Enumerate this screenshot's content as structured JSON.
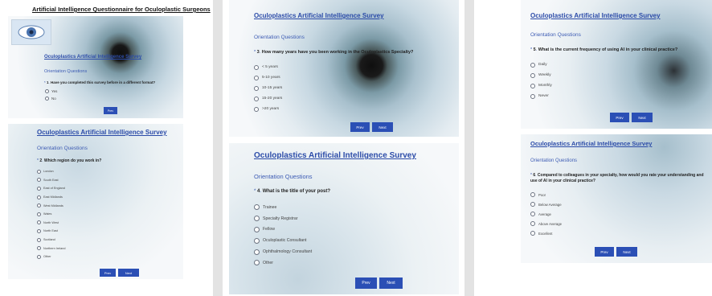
{
  "doc_title": "Artificial Intelligence Questionnaire for Oculoplastic Surgeons",
  "survey_title": "Oculoplastics Artificial Intelligence Survey",
  "section": "Orientation Questions",
  "buttons": {
    "prev": "Prev",
    "next": "Next"
  },
  "screens": [
    {
      "number": "1",
      "question": "Have you completed this survey before in a different format?",
      "options": [
        "Yes",
        "No"
      ]
    },
    {
      "number": "2",
      "question": "Which region do you work in?",
      "options": [
        "London",
        "South East",
        "East of England",
        "East Midlands",
        "West Midlands",
        "Wales",
        "North West",
        "North East",
        "Scotland",
        "Northern Ireland",
        "Other"
      ]
    },
    {
      "number": "3",
      "question": "How many years have you been working in the Oculoplastics Specialty?",
      "options": [
        "< 5 years",
        "5-10 years",
        "10-15 years",
        "15-20 years",
        ">20 years"
      ]
    },
    {
      "number": "4",
      "question": "What is the title of your post?",
      "options": [
        "Trainee",
        "Specialty Registrar",
        "Fellow",
        "Oculoplastic Consultant",
        "Ophthalmology Consultant",
        "Other"
      ]
    },
    {
      "number": "5",
      "question": "What is the current frequency of using AI in your clinical practice?",
      "options": [
        "Daily",
        "Weekly",
        "Monthly",
        "Never"
      ]
    },
    {
      "number": "6",
      "question_line1": "Compared to colleagues in your specialty, how would you rate your understanding and",
      "question_line2": "use of AI in your clinical practice?",
      "options": [
        "Poor",
        "Below Average",
        "Average",
        "Above Average",
        "Excellent"
      ]
    }
  ]
}
